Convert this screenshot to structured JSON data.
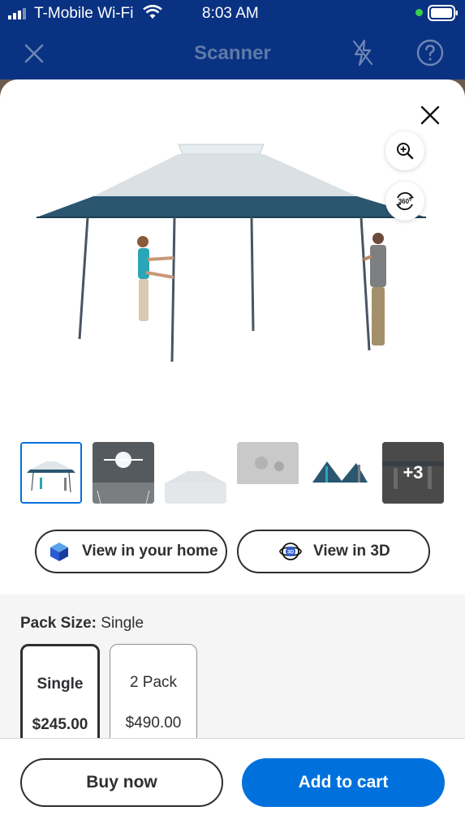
{
  "status_bar": {
    "carrier": "T-Mobile Wi-Fi",
    "time": "8:03 AM"
  },
  "header": {
    "title": "Scanner",
    "close_icon": "close-icon",
    "flash_icon": "flash-off-icon",
    "help_icon": "help-icon"
  },
  "product": {
    "view_home_label": "View in your home",
    "view_3d_label": "View in 3D",
    "more_images_label": "+3",
    "thumbnail_count": 6
  },
  "pack_size": {
    "label": "Pack Size:",
    "selected": "Single",
    "options": [
      {
        "name": "Single",
        "price": "$245.00"
      },
      {
        "name": "2 Pack",
        "price": "$490.00"
      }
    ]
  },
  "actions": {
    "buy_now": "Buy now",
    "add_to_cart": "Add to cart"
  },
  "colors": {
    "brand_blue": "#0a3282",
    "cta_blue": "#0071dc",
    "canopy_dark": "#2b5670",
    "canopy_light": "#dfe6ea"
  }
}
